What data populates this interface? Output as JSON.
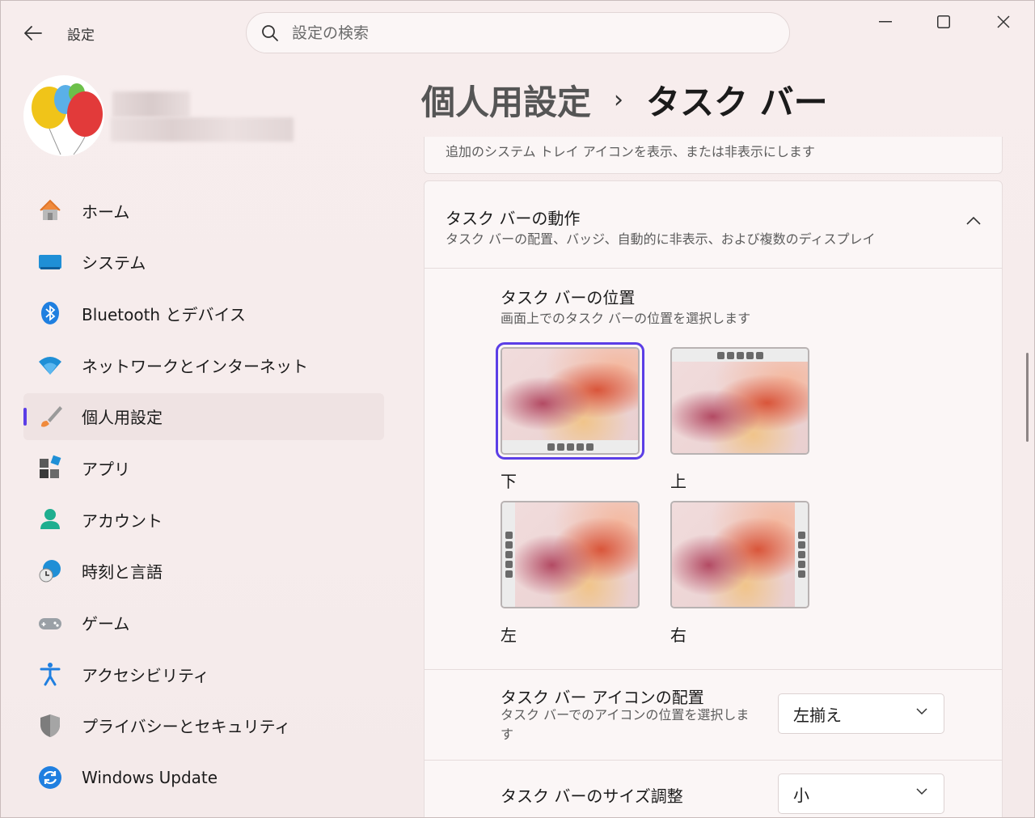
{
  "window": {
    "title": "設定"
  },
  "search": {
    "placeholder": "設定の検索"
  },
  "header": {
    "parent": "個人用設定",
    "current": "タスク バー"
  },
  "nav": {
    "items": [
      {
        "label": "ホーム",
        "icon": "home-icon"
      },
      {
        "label": "システム",
        "icon": "monitor-icon"
      },
      {
        "label": "Bluetooth とデバイス",
        "icon": "bluetooth-icon"
      },
      {
        "label": "ネットワークとインターネット",
        "icon": "wifi-icon"
      },
      {
        "label": "個人用設定",
        "icon": "brush-icon",
        "active": true
      },
      {
        "label": "アプリ",
        "icon": "apps-icon"
      },
      {
        "label": "アカウント",
        "icon": "person-icon"
      },
      {
        "label": "時刻と言語",
        "icon": "globe-clock-icon"
      },
      {
        "label": "ゲーム",
        "icon": "gamepad-icon"
      },
      {
        "label": "アクセシビリティ",
        "icon": "accessibility-icon"
      },
      {
        "label": "プライバシーとセキュリティ",
        "icon": "shield-icon"
      },
      {
        "label": "Windows Update",
        "icon": "update-icon"
      }
    ]
  },
  "content": {
    "prev_card_sub": "追加のシステム トレイ アイコンを表示、または非表示にします",
    "behavior": {
      "title": "タスク バーの動作",
      "subtitle": "タスク バーの配置、バッジ、自動的に非表示、および複数のディスプレイ"
    },
    "position": {
      "title": "タスク バーの位置",
      "subtitle": "画面上でのタスク バーの位置を選択します",
      "options": [
        {
          "label": "下",
          "selected": true
        },
        {
          "label": "上"
        },
        {
          "label": "左"
        },
        {
          "label": "右"
        }
      ]
    },
    "alignment": {
      "title": "タスク バー アイコンの配置",
      "subtitle": "タスク バーでのアイコンの位置を選択します",
      "value": "左揃え"
    },
    "size": {
      "title": "タスク バーのサイズ調整",
      "value": "小"
    }
  },
  "colors": {
    "accent": "#5b3ee6"
  }
}
